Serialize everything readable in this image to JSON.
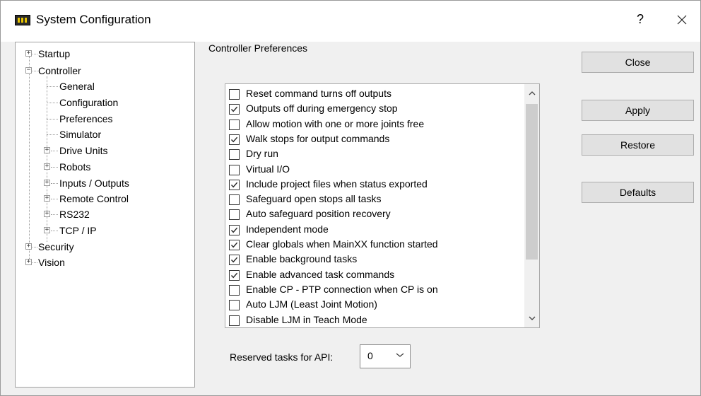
{
  "window": {
    "title": "System Configuration",
    "help_glyph": "?",
    "close_glyph": "✕",
    "icon": "controller-chip-icon"
  },
  "tree": {
    "items": [
      {
        "label": "Startup",
        "expander": "+"
      },
      {
        "label": "Controller",
        "expander": "−"
      },
      {
        "label": "General"
      },
      {
        "label": "Configuration"
      },
      {
        "label": "Preferences"
      },
      {
        "label": "Simulator"
      },
      {
        "label": "Drive Units",
        "expander": "+"
      },
      {
        "label": "Robots",
        "expander": "+"
      },
      {
        "label": "Inputs / Outputs",
        "expander": "+"
      },
      {
        "label": "Remote Control",
        "expander": "+"
      },
      {
        "label": "RS232",
        "expander": "+"
      },
      {
        "label": "TCP / IP",
        "expander": "+"
      },
      {
        "label": "Security",
        "expander": "+"
      },
      {
        "label": "Vision",
        "expander": "+"
      }
    ]
  },
  "preferences": {
    "group_title": "Controller Preferences",
    "items": [
      {
        "label": "Reset command turns off outputs",
        "checked": false
      },
      {
        "label": "Outputs off during emergency stop",
        "checked": true
      },
      {
        "label": "Allow motion with one or more joints free",
        "checked": false
      },
      {
        "label": "Walk stops for output commands",
        "checked": true
      },
      {
        "label": "Dry run",
        "checked": false
      },
      {
        "label": "Virtual I/O",
        "checked": false
      },
      {
        "label": "Include project files when status exported",
        "checked": true
      },
      {
        "label": "Safeguard open stops all tasks",
        "checked": false
      },
      {
        "label": "Auto safeguard position recovery",
        "checked": false
      },
      {
        "label": "Independent mode",
        "checked": true
      },
      {
        "label": "Clear globals when MainXX function started",
        "checked": true
      },
      {
        "label": "Enable background tasks",
        "checked": true
      },
      {
        "label": "Enable advanced task commands",
        "checked": true
      },
      {
        "label": "Enable CP - PTP connection when CP is on",
        "checked": false
      },
      {
        "label": "Auto LJM (Least Joint Motion)",
        "checked": false
      },
      {
        "label": "Disable LJM in Teach Mode",
        "checked": false
      }
    ],
    "scroll_up_glyph": "^",
    "scroll_down_glyph": "v",
    "reserved_label": "Reserved tasks for API:",
    "reserved_value": "0"
  },
  "buttons": {
    "close": "Close",
    "apply": "Apply",
    "restore": "Restore",
    "defaults": "Defaults"
  }
}
